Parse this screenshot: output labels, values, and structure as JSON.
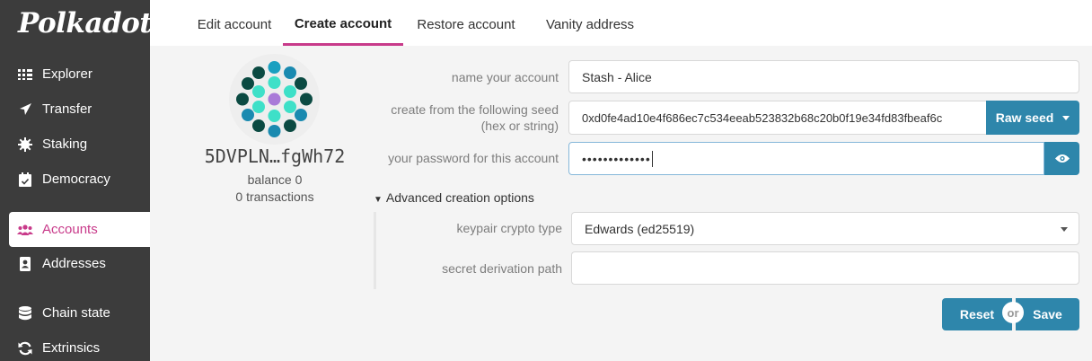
{
  "brand": {
    "name": "Polkadot",
    "dot": "."
  },
  "sidebar": {
    "items": [
      {
        "label": "Explorer",
        "icon": "explorer-icon"
      },
      {
        "label": "Transfer",
        "icon": "send-icon"
      },
      {
        "label": "Staking",
        "icon": "staking-icon"
      },
      {
        "label": "Democracy",
        "icon": "calendar-icon"
      },
      {
        "label": "Accounts",
        "icon": "users-icon",
        "active": true
      },
      {
        "label": "Addresses",
        "icon": "address-book-icon"
      },
      {
        "label": "Chain state",
        "icon": "database-icon"
      },
      {
        "label": "Extrinsics",
        "icon": "sync-icon"
      }
    ]
  },
  "tabs": [
    {
      "label": "Edit account"
    },
    {
      "label": "Create account",
      "active": true
    },
    {
      "label": "Restore account"
    },
    {
      "label": "Vanity address"
    }
  ],
  "account": {
    "address": "5DVPLN…fgWh72",
    "balance": "balance 0",
    "transactions": "0 transactions"
  },
  "form": {
    "name_label": "name your account",
    "name_value": "Stash - Alice",
    "seed_label_line1": "create from the following seed",
    "seed_label_line2": "(hex or string)",
    "seed_value": "0xd0fe4ad10e4f686ec7c534eeab523832b68c20b0f19e34fd83fbeaf6c",
    "seed_type_button": "Raw seed",
    "password_label": "your password for this account",
    "password_value": "•••••••••••••",
    "advanced_toggle": "Advanced creation options",
    "crypto_label": "keypair crypto type",
    "crypto_value": "Edwards (ed25519)",
    "derivation_label": "secret derivation path",
    "derivation_value": "",
    "reset_button": "Reset",
    "or_text": "or",
    "save_button": "Save"
  },
  "colors": {
    "accent": "#c83a8a",
    "button_blue": "#2e86ab",
    "sidebar_bg": "#3c3c3c"
  }
}
